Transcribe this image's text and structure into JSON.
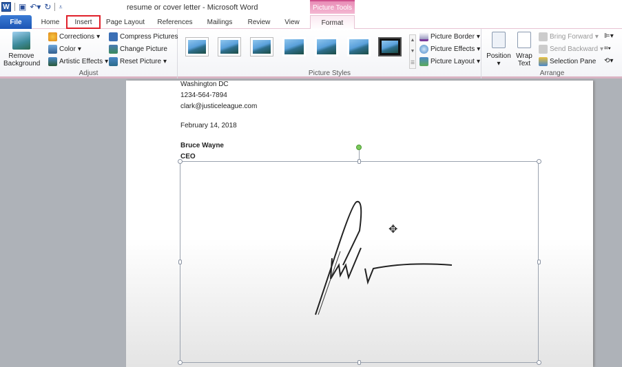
{
  "window": {
    "title": "resume or cover letter  -  Microsoft Word",
    "context_tab": "Picture Tools",
    "app_icon": "W"
  },
  "qat": {
    "icons": [
      "save-icon",
      "undo-icon",
      "redo-icon",
      "customize-icon"
    ]
  },
  "tabs": [
    {
      "label": "File"
    },
    {
      "label": "Home"
    },
    {
      "label": "Insert",
      "highlighted": true
    },
    {
      "label": "Page Layout"
    },
    {
      "label": "References"
    },
    {
      "label": "Mailings"
    },
    {
      "label": "Review"
    },
    {
      "label": "View"
    },
    {
      "label": "Format",
      "active": true
    }
  ],
  "ribbon": {
    "adjust": {
      "label": "Adjust",
      "remove_bg": "Remove Background",
      "corrections": "Corrections",
      "color": "Color",
      "artistic": "Artistic Effects",
      "compress": "Compress Pictures",
      "change": "Change Picture",
      "reset": "Reset Picture"
    },
    "styles": {
      "label": "Picture Styles",
      "border": "Picture Border",
      "effects": "Picture Effects",
      "layout": "Picture Layout",
      "thumb_count": 7,
      "selected_index": 6
    },
    "arrange": {
      "label": "Arrange",
      "position": "Position",
      "wrap": "Wrap Text",
      "bring": "Bring Forward",
      "send": "Send Backward",
      "selection": "Selection Pane"
    }
  },
  "document": {
    "lines": [
      "Washington  DC",
      "1234-564-7894",
      "clark@justiceleague.com",
      "February 14, 2018",
      "Bruce Wayne",
      "CEO"
    ]
  },
  "colors": {
    "file_tab": "#2a62c2",
    "context": "#e88cb6",
    "highlight": "#e0202a"
  }
}
